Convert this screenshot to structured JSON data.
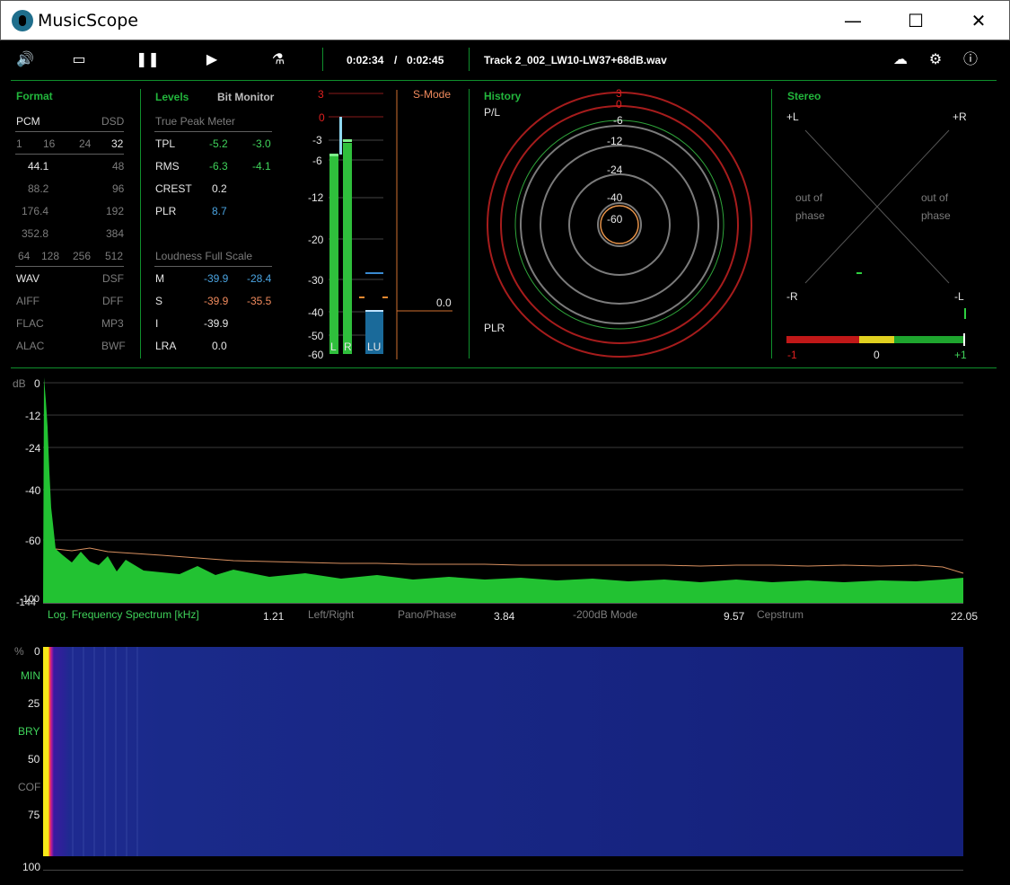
{
  "window": {
    "title": "MusicScope",
    "minimize": "—",
    "maximize": "☐",
    "close": "✕"
  },
  "toolbar": {
    "time_current": "0:02:34",
    "time_separator": "/",
    "time_total": "0:02:45",
    "track_name": "Track 2_002_LW10-LW37+68dB.wav"
  },
  "format": {
    "header": "Format",
    "pcm": "PCM",
    "dsd": "DSD",
    "bits": [
      "1",
      "16",
      "24",
      "32"
    ],
    "rates_left": [
      "44.1",
      "88.2",
      "176.4",
      "352.8"
    ],
    "rates_right": [
      "48",
      "96",
      "192",
      "384"
    ],
    "dsd_rates": [
      "64",
      "128",
      "256",
      "512"
    ],
    "types_left": [
      "WAV",
      "AIFF",
      "FLAC",
      "ALAC"
    ],
    "types_right": [
      "DSF",
      "DFF",
      "MP3",
      "BWF"
    ]
  },
  "levels": {
    "header": "Levels",
    "bit_monitor": "Bit Monitor",
    "true_peak_title": "True Peak Meter",
    "rows": [
      {
        "label": "TPL",
        "a": "-5.2",
        "b": "-3.0"
      },
      {
        "label": "RMS",
        "a": "-6.3",
        "b": "-4.1"
      },
      {
        "label": "CREST",
        "a": "0.2",
        "b": ""
      },
      {
        "label": "PLR",
        "a": "8.7",
        "b": ""
      }
    ],
    "loudness_title": "Loudness Full Scale",
    "loud_rows": [
      {
        "label": "M",
        "a": "-39.9",
        "b": "-28.4"
      },
      {
        "label": "S",
        "a": "-39.9",
        "b": "-35.5"
      },
      {
        "label": "I",
        "a": "-39.9",
        "b": ""
      },
      {
        "label": "LRA",
        "a": "0.0",
        "b": ""
      }
    ]
  },
  "meter": {
    "scale": [
      "3",
      "0",
      "-3",
      "-6",
      "-12",
      "-20",
      "-30",
      "-40",
      "-50",
      "-60"
    ],
    "labels": [
      "L",
      "R",
      "LU"
    ],
    "s_mode": "S-Mode",
    "s_value": "0.0"
  },
  "history": {
    "header": "History",
    "pl": "P/L",
    "plr": "PLR",
    "ring_labels": [
      "3",
      "0",
      "-6",
      "-12",
      "-24",
      "-40",
      "-60"
    ]
  },
  "stereo": {
    "header": "Stereo",
    "l_plus": "+L",
    "r_plus": "+R",
    "r_minus": "-R",
    "l_minus": "-L",
    "out_of": "out of",
    "phase": "phase",
    "scale": [
      "-1",
      "0",
      "+1"
    ]
  },
  "spectrum": {
    "unit": "dB",
    "y_ticks": [
      "0",
      "-12",
      "-24",
      "-40",
      "-60",
      "-100",
      "-144"
    ],
    "title": "Log. Frequency Spectrum [kHz]",
    "x_ticks": [
      "1.21",
      "3.84",
      "9.57",
      "22.05"
    ],
    "modes": [
      "Left/Right",
      "Pano/Phase",
      "-200dB Mode",
      "Cepstrum"
    ]
  },
  "spectrogram": {
    "unit": "%",
    "y_ticks": [
      "0",
      "25",
      "50",
      "75",
      "100"
    ],
    "side_labels": [
      "MIN",
      "BRY",
      "COF"
    ]
  }
}
